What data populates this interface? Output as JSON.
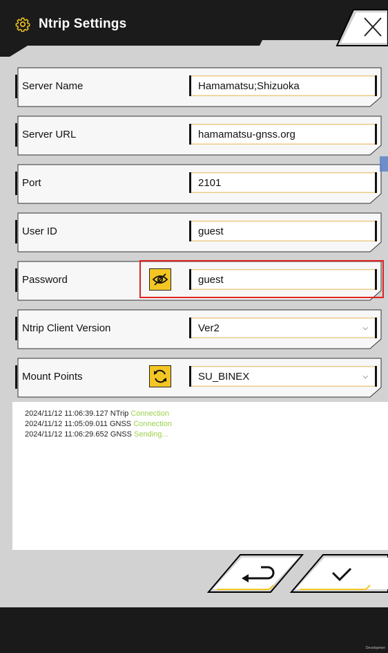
{
  "header": {
    "title": "Ntrip Settings"
  },
  "fields": [
    {
      "label": "Server Name",
      "value": "Hamamatsu;Shizuoka"
    },
    {
      "label": "Server URL",
      "value": "hamamatsu-gnss.org"
    },
    {
      "label": "Port",
      "value": "2101"
    },
    {
      "label": "User ID",
      "value": "guest"
    },
    {
      "label": "Password",
      "value": "guest"
    },
    {
      "label": "Ntrip Client Version",
      "value": "Ver2"
    },
    {
      "label": "Mount Points",
      "value": "SU_BINEX"
    }
  ],
  "log": [
    {
      "time": "2024/11/12 11:06:39.127",
      "source": "NTrip",
      "status": "Connection"
    },
    {
      "time": "2024/11/12 11:05:09.011",
      "source": "GNSS",
      "status": "Connection"
    },
    {
      "time": "2024/11/12 11:06:29.652",
      "source": "GNSS",
      "status": "Sending..."
    }
  ],
  "footer": {
    "brand": "Developmen"
  },
  "colors": {
    "accent": "#f4c623",
    "highlight": "#e02020",
    "status": "#9bd14a"
  },
  "icons": [
    "gear-icon",
    "close-icon",
    "eye-off-icon",
    "refresh-icon",
    "return-icon",
    "check-icon"
  ]
}
